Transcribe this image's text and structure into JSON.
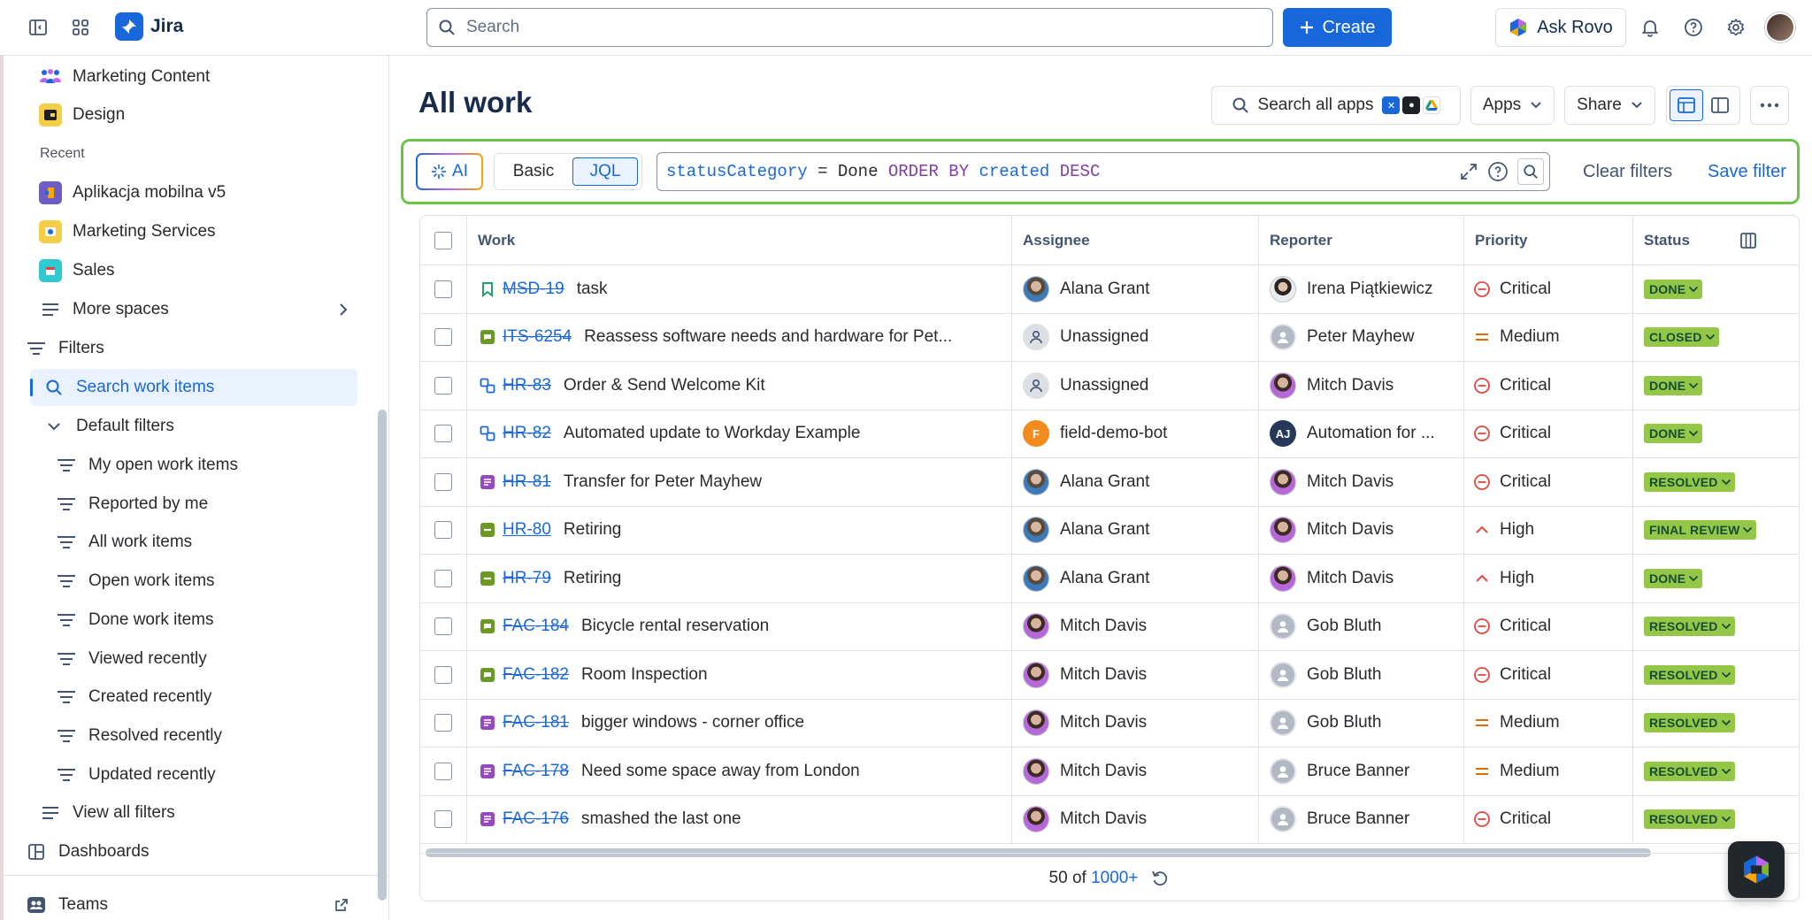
{
  "app": {
    "title": "Jira"
  },
  "topbar": {
    "search_placeholder": "Search",
    "create_label": "Create",
    "ask_rovo_label": "Ask Rovo"
  },
  "sidebar": {
    "items_top": [
      {
        "label": "Marketing Content",
        "icon": "team-icon"
      },
      {
        "label": "Design",
        "icon": "design-project-icon"
      }
    ],
    "recent_heading": "Recent",
    "recent": [
      {
        "label": "Aplikacja mobilna v5",
        "icon": "mobile-project-icon"
      },
      {
        "label": "Marketing Services",
        "icon": "services-project-icon"
      },
      {
        "label": "Sales",
        "icon": "sales-project-icon"
      }
    ],
    "more_spaces": "More spaces",
    "filters": "Filters",
    "search_work_items": "Search work items",
    "default_filters": "Default filters",
    "filter_items": [
      "My open work items",
      "Reported by me",
      "All work items",
      "Open work items",
      "Done work items",
      "Viewed recently",
      "Created recently",
      "Resolved recently",
      "Updated recently"
    ],
    "view_all_filters": "View all filters",
    "dashboards": "Dashboards",
    "teams": "Teams"
  },
  "page": {
    "title": "All work",
    "search_all_apps": "Search all apps",
    "apps_label": "Apps",
    "share_label": "Share"
  },
  "jql": {
    "ai_label": "AI",
    "basic_label": "Basic",
    "jql_label": "JQL",
    "query": {
      "field": "statusCategory",
      "op": "=",
      "value": "Done",
      "order_by": "ORDER BY",
      "order_field": "created",
      "direction": "DESC"
    },
    "clear_filters": "Clear filters",
    "save_filter": "Save filter"
  },
  "table": {
    "columns": [
      "Work",
      "Assignee",
      "Reporter",
      "Priority",
      "Status"
    ],
    "rows": [
      {
        "key": "MSD-19",
        "summary": "task",
        "type": "story",
        "assignee": "Alana Grant",
        "assignee_av": "photo",
        "reporter": "Irena Piątkiewicz",
        "reporter_av": "irena",
        "priority": "Critical",
        "status": "DONE",
        "done": true
      },
      {
        "key": "ITS-6254",
        "summary": "Reassess software needs and hardware for Pet...",
        "type": "service",
        "assignee": "Unassigned",
        "assignee_av": "empty",
        "reporter": "Peter Mayhew",
        "reporter_av": "grey",
        "priority": "Medium",
        "status": "CLOSED",
        "done": true
      },
      {
        "key": "HR-83",
        "summary": "Order & Send Welcome Kit",
        "type": "subtask",
        "assignee": "Unassigned",
        "assignee_av": "empty",
        "reporter": "Mitch Davis",
        "reporter_av": "mitch",
        "priority": "Critical",
        "status": "DONE",
        "done": true
      },
      {
        "key": "HR-82",
        "summary": "Automated update to Workday Example",
        "type": "subtask",
        "assignee": "field-demo-bot",
        "assignee_av": "bot",
        "reporter": "Automation for ...",
        "reporter_av": "aj",
        "priority": "Critical",
        "status": "DONE",
        "done": true
      },
      {
        "key": "HR-81",
        "summary": "Transfer for Peter Mayhew",
        "type": "request",
        "assignee": "Alana Grant",
        "assignee_av": "photo",
        "reporter": "Mitch Davis",
        "reporter_av": "mitch",
        "priority": "Critical",
        "status": "RESOLVED",
        "done": true
      },
      {
        "key": "HR-80",
        "summary": "Retiring",
        "type": "task",
        "assignee": "Alana Grant",
        "assignee_av": "photo",
        "reporter": "Mitch Davis",
        "reporter_av": "mitch",
        "priority": "High",
        "status": "FINAL REVIEW",
        "done": false
      },
      {
        "key": "HR-79",
        "summary": "Retiring",
        "type": "task",
        "assignee": "Alana Grant",
        "assignee_av": "photo",
        "reporter": "Mitch Davis",
        "reporter_av": "mitch",
        "priority": "High",
        "status": "DONE",
        "done": true
      },
      {
        "key": "FAC-184",
        "summary": "Bicycle rental reservation",
        "type": "service",
        "assignee": "Mitch Davis",
        "assignee_av": "mitch",
        "reporter": "Gob Bluth",
        "reporter_av": "grey",
        "priority": "Critical",
        "status": "RESOLVED",
        "done": true
      },
      {
        "key": "FAC-182",
        "summary": "Room Inspection",
        "type": "service",
        "assignee": "Mitch Davis",
        "assignee_av": "mitch",
        "reporter": "Gob Bluth",
        "reporter_av": "grey",
        "priority": "Critical",
        "status": "RESOLVED",
        "done": true
      },
      {
        "key": "FAC-181",
        "summary": "bigger windows - corner office",
        "type": "request",
        "assignee": "Mitch Davis",
        "assignee_av": "mitch",
        "reporter": "Gob Bluth",
        "reporter_av": "grey",
        "priority": "Medium",
        "status": "RESOLVED",
        "done": true
      },
      {
        "key": "FAC-178",
        "summary": "Need some space away from London",
        "type": "request",
        "assignee": "Mitch Davis",
        "assignee_av": "mitch",
        "reporter": "Bruce Banner",
        "reporter_av": "grey",
        "priority": "Medium",
        "status": "RESOLVED",
        "done": true
      },
      {
        "key": "FAC-176",
        "summary": "smashed the last one",
        "type": "request",
        "assignee": "Mitch Davis",
        "assignee_av": "mitch",
        "reporter": "Bruce Banner",
        "reporter_av": "grey",
        "priority": "Critical",
        "status": "RESOLVED",
        "done": true
      }
    ],
    "footer": {
      "shown": "50 of",
      "total": "1000+"
    }
  },
  "colors": {
    "brand": "#1868db",
    "jql_highlight": "#6cc34a",
    "done_lozenge": "#94c748",
    "critical": "#e2483d",
    "medium": "#e06c00"
  }
}
